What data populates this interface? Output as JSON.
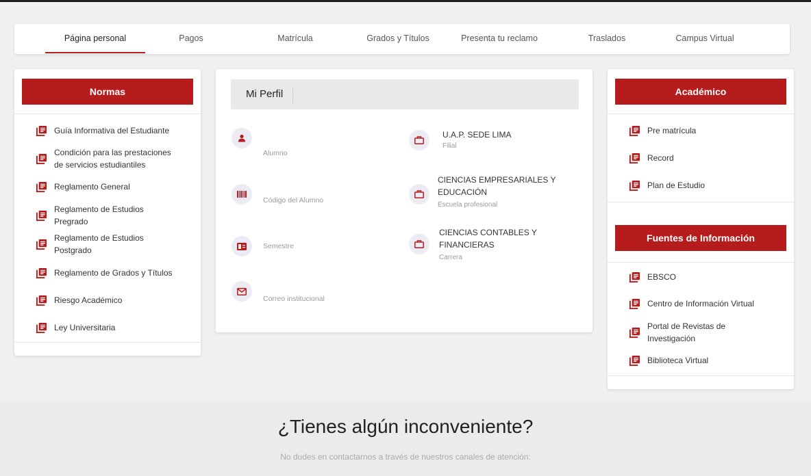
{
  "colors": {
    "accent": "#b71c1c",
    "icon_bg": "#ecebf4",
    "footer_bg": "#ebebeb"
  },
  "nav": {
    "items": [
      {
        "label": "Página personal",
        "active": true
      },
      {
        "label": "Pagos"
      },
      {
        "label": "Matrícula"
      },
      {
        "label": "Grados y Títulos"
      },
      {
        "label": "Presenta tu reclamo"
      },
      {
        "label": "Traslados"
      },
      {
        "label": "Campus Virtual"
      }
    ]
  },
  "normas": {
    "title": "Normas",
    "links": [
      "Guía Informativa del Estudiante",
      "Condición para las prestaciones de servicios estudiantiles",
      "Reglamento General",
      "Reglamento de Estudios Pregrado",
      "Reglamento de Estudios Postgrado",
      "Reglamento de Grados y Títulos",
      "Riesgo Académico",
      "Ley Universitaria"
    ]
  },
  "profile": {
    "title": "Mi Perfil",
    "left": [
      {
        "icon": "person-icon",
        "label": "Alumno"
      },
      {
        "icon": "barcode-icon",
        "label": "Código del Alumno"
      },
      {
        "icon": "id-card-icon",
        "label": "Semestre"
      },
      {
        "icon": "envelope-icon",
        "label": "Correo institucional"
      }
    ],
    "right": [
      {
        "icon": "briefcase-icon",
        "value": "U.A.P. SEDE LIMA",
        "label": "Filial"
      },
      {
        "icon": "briefcase-icon",
        "value": "CIENCIAS EMPRESARIALES Y EDUCACIÓN",
        "label": "Escuela profesional"
      },
      {
        "icon": "briefcase-icon",
        "value": "CIENCIAS CONTABLES Y FINANCIERAS",
        "label": "Carrera"
      }
    ]
  },
  "academico": {
    "title": "Académico",
    "links": [
      "Pre matrícula",
      "Record",
      "Plan de Estudio"
    ]
  },
  "fuentes": {
    "title": "Fuentes de Información",
    "links": [
      "EBSCO",
      "Centro de Información Virtual",
      "Portal de Revistas de Investigación",
      "Biblioteca Virtual"
    ]
  },
  "footer": {
    "title": "¿Tienes algún inconveniente?",
    "subtitle": "No dudes en contactarnos a través de nuestros canales de atención:"
  }
}
